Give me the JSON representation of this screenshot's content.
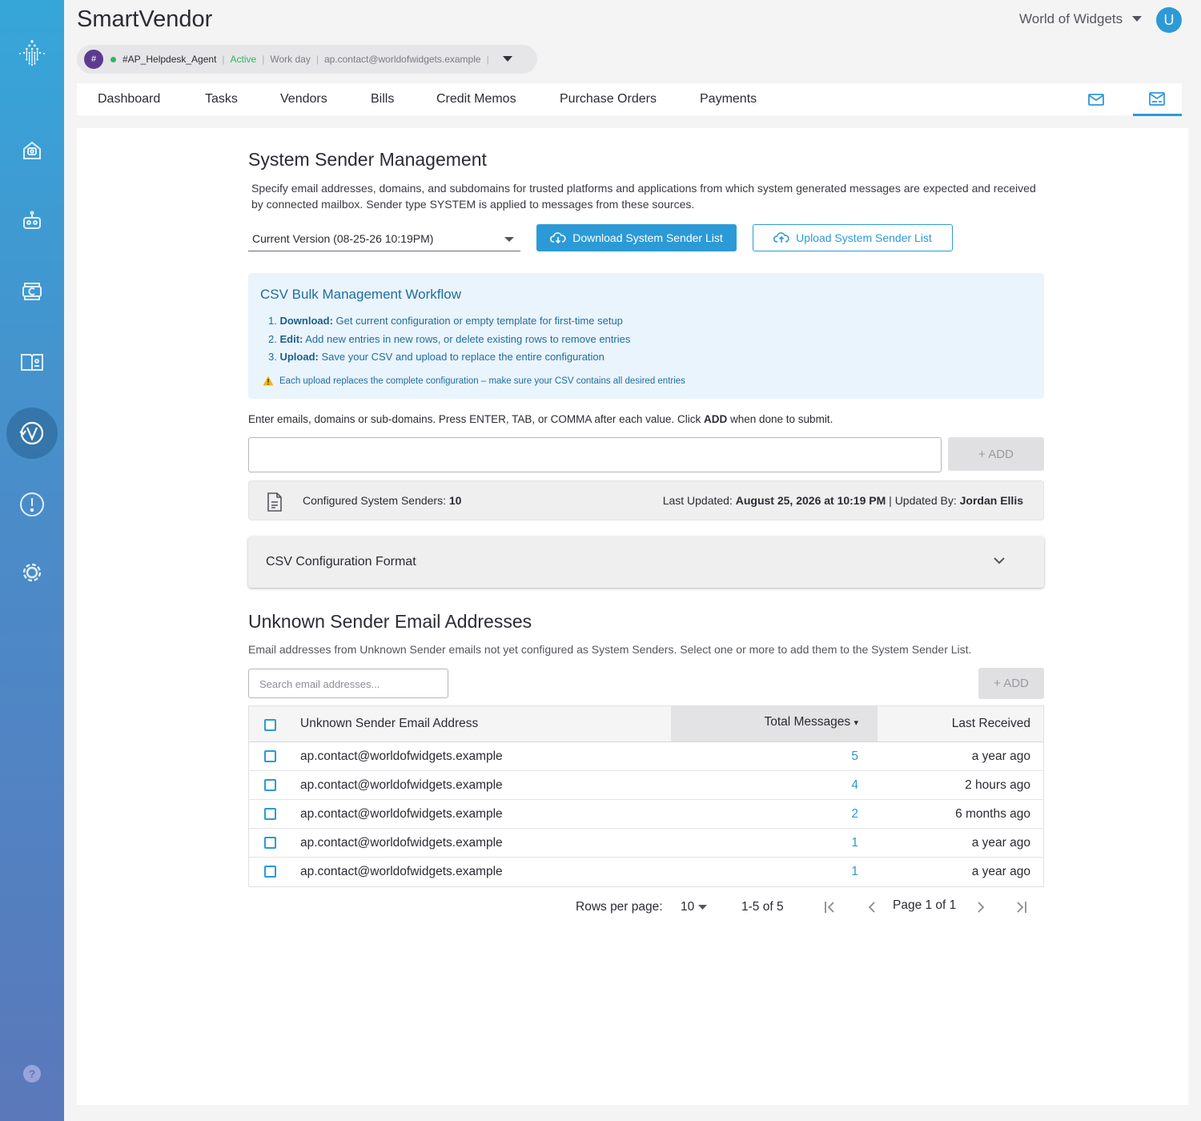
{
  "app": {
    "title": "SmartVendor",
    "org": "World of Widgets",
    "user_initial": "U"
  },
  "agent": {
    "hash": "#",
    "name": "#AP_Helpdesk_Agent",
    "status": "Active",
    "schedule": "Work day",
    "email": "ap.contact@worldofwidgets.example"
  },
  "sidebar": {
    "items": [
      "home-icon",
      "robot-icon",
      "cycle-c-icon",
      "book-icon",
      "vendor-v-icon",
      "alert-icon",
      "settings-icon"
    ],
    "help_icon": "help-icon"
  },
  "nav": {
    "tabs": [
      "Dashboard",
      "Tasks",
      "Vendors",
      "Bills",
      "Credit Memos",
      "Purchase Orders",
      "Payments"
    ],
    "icons": [
      "mail-icon",
      "mail-settings-icon"
    ]
  },
  "system_sender": {
    "title": "System Sender Management",
    "description": "Specify email addresses, domains, and subdomains for trusted platforms and applications from which system generated messages are expected and received by connected mailbox. Sender type SYSTEM is applied to messages from these sources.",
    "version": "Current Version (08-25-26 10:19PM)",
    "download_label": "Download System Sender List",
    "upload_label": "Upload System Sender List"
  },
  "workflow": {
    "title": "CSV Bulk Management Workflow",
    "steps": [
      {
        "num": "1.",
        "bold": "Download:",
        "text": "Get current configuration or empty template for first-time setup"
      },
      {
        "num": "2.",
        "bold": "Edit:",
        "text": "Add new entries in new rows, or delete existing rows to remove entries"
      },
      {
        "num": "3.",
        "bold": "Upload:",
        "text": "Save your CSV and upload to replace the entire configuration"
      }
    ],
    "warning": "Each upload replaces the complete configuration – make sure your CSV contains all desired entries"
  },
  "entry": {
    "hint_prefix": "Enter emails, domains or sub-domains. Press ENTER, TAB, or COMMA after each value. Click",
    "hint_bold": "ADD",
    "hint_suffix": "when done to submit.",
    "value": "",
    "add_label": "+ ADD"
  },
  "summary": {
    "configured_label": "Configured System Senders:",
    "configured_count": "10",
    "updated_label": "Last Updated:",
    "updated_value": "August 25, 2026 at 10:19 PM",
    "updated_by_label": "| Updated By:",
    "updated_by": "Jordan Ellis"
  },
  "csv_format": {
    "title": "CSV Configuration Format"
  },
  "unknown": {
    "title": "Unknown Sender Email Addresses",
    "description": "Email addresses from Unknown Sender emails not yet configured as System Senders. Select one or more to add them to the System Sender List.",
    "search_placeholder": "Search email addresses...",
    "add_label": "+ ADD",
    "columns": [
      "Unknown Sender Email Address",
      "Total Messages",
      "Last Received"
    ],
    "sort_indicator": "▾",
    "rows": [
      {
        "email": "ap.contact@worldofwidgets.example",
        "total": "5",
        "last": "a year ago"
      },
      {
        "email": "ap.contact@worldofwidgets.example",
        "total": "4",
        "last": "2 hours ago"
      },
      {
        "email": "ap.contact@worldofwidgets.example",
        "total": "2",
        "last": "6 months ago"
      },
      {
        "email": "ap.contact@worldofwidgets.example",
        "total": "1",
        "last": "a year ago"
      },
      {
        "email": "ap.contact@worldofwidgets.example",
        "total": "1",
        "last": "a year ago"
      }
    ]
  },
  "pagination": {
    "rows_label": "Rows per page:",
    "rows_value": "10",
    "range": "1-5 of 5",
    "page_text": "Page 1 of 1"
  },
  "colors": {
    "accent": "#2c9ad6",
    "active": "#2eb85c",
    "info_bg": "#eaf4fd"
  }
}
